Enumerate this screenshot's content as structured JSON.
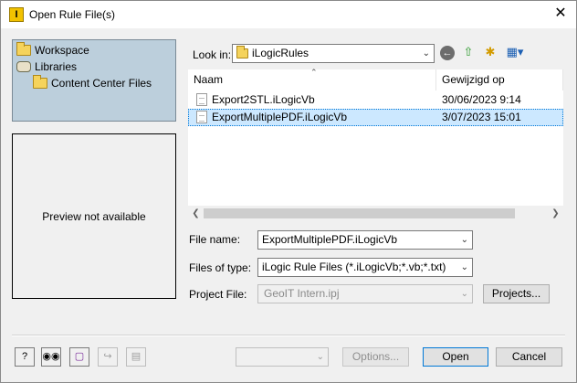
{
  "window": {
    "title": "Open Rule File(s)",
    "app_icon": "inventor-icon",
    "close_glyph": "✕"
  },
  "places": [
    {
      "label": "Workspace",
      "icon": "folder-icon"
    },
    {
      "label": "Libraries",
      "icon": "libraries-icon"
    },
    {
      "label": "Content Center Files",
      "icon": "folder-icon"
    }
  ],
  "preview": {
    "text": "Preview not available"
  },
  "lookin": {
    "label": "Look in:",
    "value": "iLogicRules"
  },
  "columns": {
    "name": "Naam",
    "modified": "Gewijzigd op"
  },
  "files": [
    {
      "name": "Export2STL.iLogicVb",
      "modified": "30/06/2023 9:14",
      "selected": false
    },
    {
      "name": "ExportMultiplePDF.iLogicVb",
      "modified": "3/07/2023 15:01",
      "selected": true
    }
  ],
  "filename": {
    "label": "File name:",
    "value": "ExportMultiplePDF.iLogicVb"
  },
  "filetype": {
    "label": "Files of type:",
    "value": "iLogic Rule Files (*.iLogicVb;*.vb;*.txt)"
  },
  "project": {
    "label": "Project File:",
    "value": "GeoIT Intern.ipj",
    "projects_button": "Projects..."
  },
  "buttons": {
    "options": "Options...",
    "open": "Open",
    "cancel": "Cancel"
  },
  "colors": {
    "places_bg": "#bccfdc",
    "selection": "#cce8ff",
    "accent": "#0078d7"
  }
}
